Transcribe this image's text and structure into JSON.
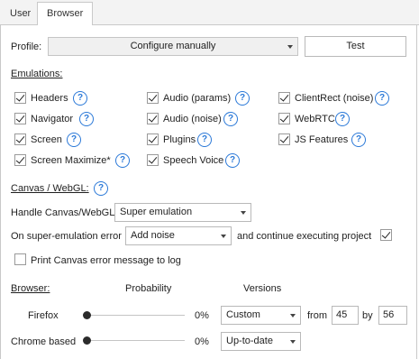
{
  "tabs": [
    "User",
    "Browser"
  ],
  "profile": {
    "label": "Profile:",
    "value": "Configure manually",
    "test_button": "Test"
  },
  "emulations": {
    "title": "Emulations:",
    "items": [
      {
        "label": "Headers",
        "checked": true
      },
      {
        "label": "Audio (params)",
        "checked": true
      },
      {
        "label": "ClientRect (noise)",
        "checked": true
      },
      {
        "label": "Navigator",
        "checked": true
      },
      {
        "label": "Audio (noise)",
        "checked": true
      },
      {
        "label": "WebRTC",
        "checked": true
      },
      {
        "label": "Screen",
        "checked": true
      },
      {
        "label": "Plugins",
        "checked": true
      },
      {
        "label": "JS Features",
        "checked": true
      },
      {
        "label": "Screen Maximize*",
        "checked": true
      },
      {
        "label": "Speech Voice",
        "checked": true
      }
    ]
  },
  "canvas": {
    "title": "Canvas / WebGL:",
    "handle_label": "Handle Canvas/WebGL",
    "handle_value": "Super emulation",
    "error_label": "On super-emulation error",
    "error_value": "Add noise",
    "continue_label": "and continue executing project",
    "continue_checked": true,
    "print_label": "Print Canvas error message to log",
    "print_checked": false
  },
  "browser": {
    "title": "Browser:",
    "probability_header": "Probability",
    "versions_header": "Versions",
    "rows": [
      {
        "name": "Firefox",
        "probability": "0%",
        "version_mode": "Custom",
        "from_label": "from",
        "from": "45",
        "by_label": "by",
        "to": "56"
      },
      {
        "name": "Chrome based",
        "probability": "0%",
        "version_mode": "Up-to-date"
      }
    ]
  },
  "icons": {
    "help": "?"
  }
}
